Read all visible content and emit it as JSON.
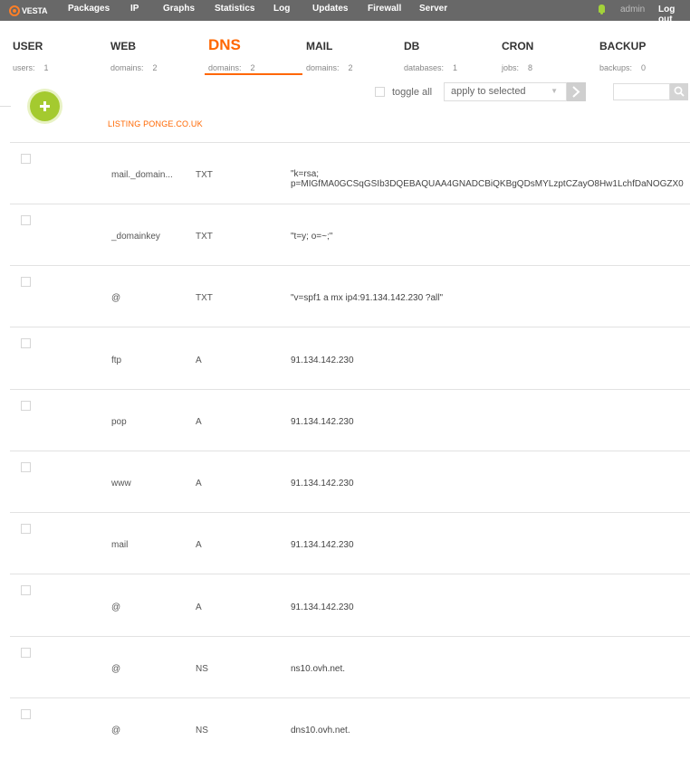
{
  "topbar": {
    "logo_text": "VESTA",
    "nav": [
      "Packages",
      "IP",
      "Graphs",
      "Statistics",
      "Log",
      "Updates",
      "Firewall",
      "Server"
    ],
    "user": "admin",
    "logout": "Log out"
  },
  "sections": [
    {
      "name": "USER",
      "stat_label": "users:",
      "stat_value": "1"
    },
    {
      "name": "WEB",
      "stat_label": "domains:",
      "stat_value": "2"
    },
    {
      "name": "DNS",
      "stat_label": "domains:",
      "stat_value": "2"
    },
    {
      "name": "MAIL",
      "stat_label": "domains:",
      "stat_value": "2"
    },
    {
      "name": "DB",
      "stat_label": "databases:",
      "stat_value": "1"
    },
    {
      "name": "CRON",
      "stat_label": "jobs:",
      "stat_value": "8"
    },
    {
      "name": "BACKUP",
      "stat_label": "backups:",
      "stat_value": "0"
    }
  ],
  "active_section": "DNS",
  "toolbar": {
    "toggle_all": "toggle all",
    "apply_selected": "apply to selected",
    "search_placeholder": ""
  },
  "listing_title": "LISTING PONGE.CO.UK",
  "records": [
    {
      "name": "mail._domain...",
      "type": "TXT",
      "value_lines": [
        "\"k=rsa;",
        "p=MIGfMA0GCSqGSIb3DQEBAQUAA4GNADCBiQKBgQDsMYLzptCZayO8Hw1LchfDaNOGZX0"
      ]
    },
    {
      "name": "_domainkey",
      "type": "TXT",
      "value_lines": [
        "\"t=y; o=~;\""
      ]
    },
    {
      "name": "@",
      "type": "TXT",
      "value_lines": [
        "\"v=spf1 a mx ip4:91.134.142.230 ?all\""
      ]
    },
    {
      "name": "ftp",
      "type": "A",
      "value_lines": [
        "91.134.142.230"
      ]
    },
    {
      "name": "pop",
      "type": "A",
      "value_lines": [
        "91.134.142.230"
      ]
    },
    {
      "name": "www",
      "type": "A",
      "value_lines": [
        "91.134.142.230"
      ]
    },
    {
      "name": "mail",
      "type": "A",
      "value_lines": [
        "91.134.142.230"
      ]
    },
    {
      "name": "@",
      "type": "A",
      "value_lines": [
        "91.134.142.230"
      ]
    },
    {
      "name": "@",
      "type": "NS",
      "value_lines": [
        "ns10.ovh.net."
      ]
    },
    {
      "name": "@",
      "type": "NS",
      "value_lines": [
        "dns10.ovh.net."
      ]
    }
  ],
  "icons": {
    "logo": "vesta-logo-icon",
    "notifications": "bell-icon",
    "add": "plus-icon",
    "apply": "chevron-right-icon",
    "search": "search-icon"
  },
  "colors": {
    "accent": "#ff6701",
    "topbar": "#686868",
    "add_button": "#a4ca2f",
    "bell": "#a3d23a"
  }
}
